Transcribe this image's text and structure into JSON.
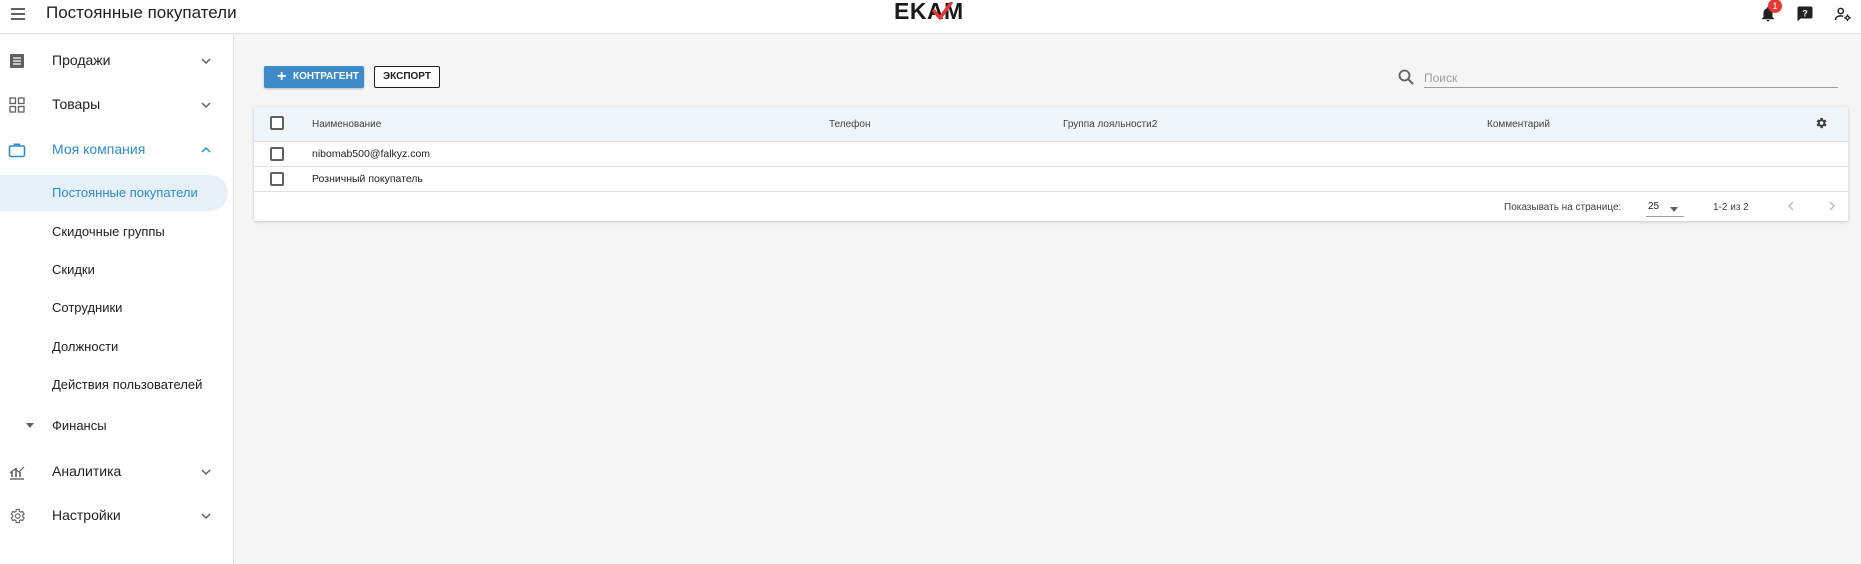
{
  "header": {
    "title": "Постоянные покупатели",
    "logo_text": "EKAM",
    "notification_count": "1"
  },
  "sidebar": {
    "items": [
      {
        "label": "Продажи",
        "icon": "receipt-icon"
      },
      {
        "label": "Товары",
        "icon": "grid-icon"
      },
      {
        "label": "Моя компания",
        "icon": "briefcase-icon"
      },
      {
        "label": "Аналитика",
        "icon": "analytics-icon"
      },
      {
        "label": "Настройки",
        "icon": "gear-icon"
      }
    ],
    "company_subitems": [
      "Постоянные покупатели",
      "Скидочные группы",
      "Скидки",
      "Сотрудники",
      "Должности",
      "Действия пользователей"
    ],
    "finance_label": "Финансы"
  },
  "toolbar": {
    "add_label": "КОНТРАГЕНТ",
    "export_label": "ЭКСПОРТ",
    "search_placeholder": "Поиск"
  },
  "table": {
    "columns": [
      "Наименование",
      "Телефон",
      "Группа лояльности2",
      "Комментарий"
    ],
    "rows": [
      {
        "name": "nibomab500@falkyz.com",
        "phone": "",
        "group": "",
        "comment": ""
      },
      {
        "name": "Розничный покупатель",
        "phone": "",
        "group": "",
        "comment": ""
      }
    ]
  },
  "pagination": {
    "per_page_label": "Показывать на странице:",
    "per_page_value": "25",
    "range": "1-2 из 2"
  },
  "colors": {
    "accent": "#3d8cc9",
    "active_text": "#2e8bc9",
    "header_bg": "#eef6fb",
    "badge": "#e53935"
  }
}
